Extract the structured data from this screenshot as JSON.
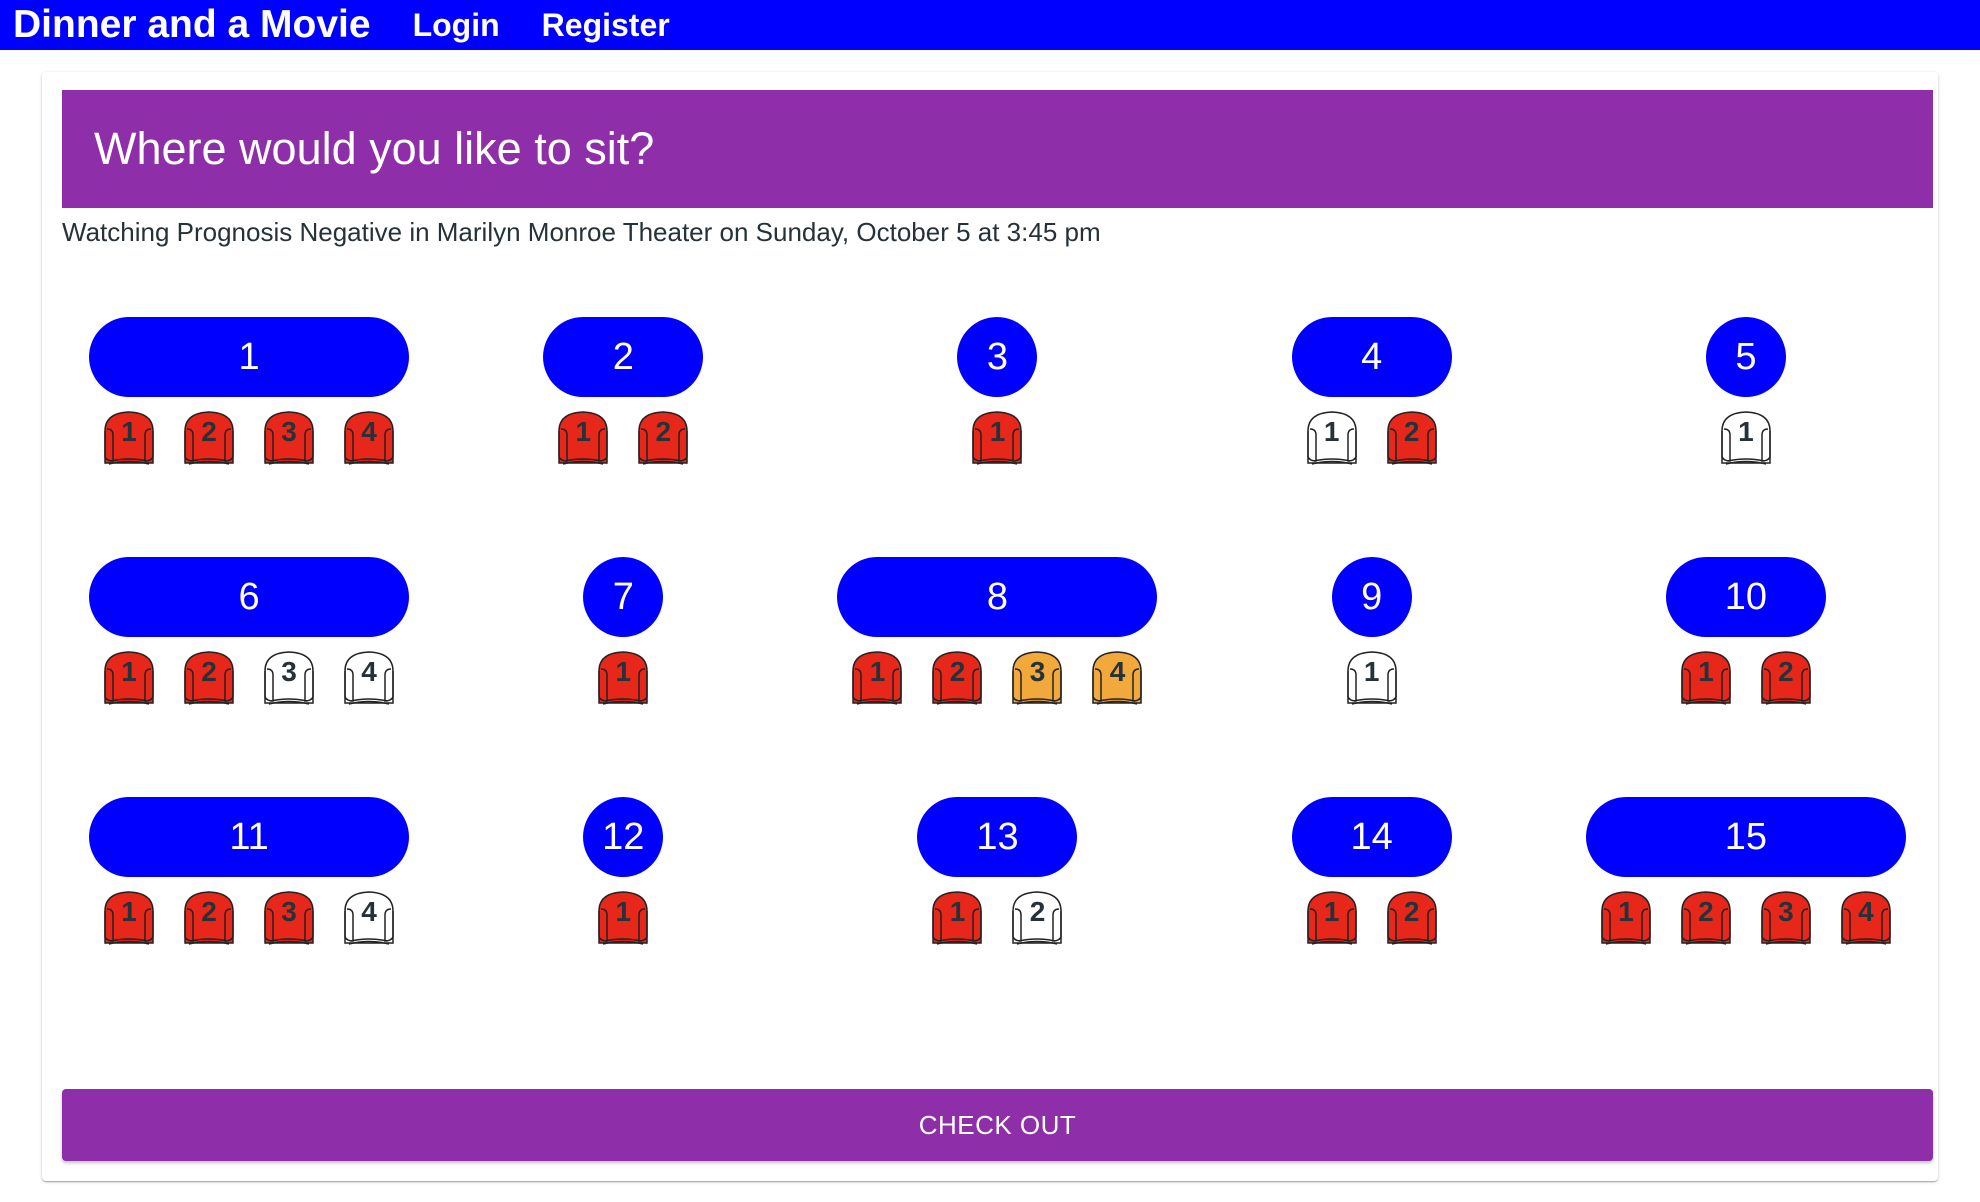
{
  "navbar": {
    "brand": "Dinner and a Movie",
    "links": [
      "Login",
      "Register"
    ],
    "background": "#0000ff"
  },
  "header": {
    "title": "Where would you like to sit?",
    "background": "#8e2fa9"
  },
  "subtitle": "Watching Prognosis Negative in Marilyn Monroe Theater on Sunday, October 5 at 3:45 pm",
  "seat_colors": {
    "taken": "#e8271b",
    "selected": "#f2a93b",
    "available": "#ffffff"
  },
  "tables": [
    {
      "label": "1",
      "seats": [
        {
          "number": "1",
          "status": "taken"
        },
        {
          "number": "2",
          "status": "taken"
        },
        {
          "number": "3",
          "status": "taken"
        },
        {
          "number": "4",
          "status": "taken"
        }
      ]
    },
    {
      "label": "2",
      "seats": [
        {
          "number": "1",
          "status": "taken"
        },
        {
          "number": "2",
          "status": "taken"
        }
      ]
    },
    {
      "label": "3",
      "seats": [
        {
          "number": "1",
          "status": "taken"
        }
      ]
    },
    {
      "label": "4",
      "seats": [
        {
          "number": "1",
          "status": "available"
        },
        {
          "number": "2",
          "status": "taken"
        }
      ]
    },
    {
      "label": "5",
      "seats": [
        {
          "number": "1",
          "status": "available"
        }
      ]
    },
    {
      "label": "6",
      "seats": [
        {
          "number": "1",
          "status": "taken"
        },
        {
          "number": "2",
          "status": "taken"
        },
        {
          "number": "3",
          "status": "available"
        },
        {
          "number": "4",
          "status": "available"
        }
      ]
    },
    {
      "label": "7",
      "seats": [
        {
          "number": "1",
          "status": "taken"
        }
      ]
    },
    {
      "label": "8",
      "seats": [
        {
          "number": "1",
          "status": "taken"
        },
        {
          "number": "2",
          "status": "taken"
        },
        {
          "number": "3",
          "status": "selected"
        },
        {
          "number": "4",
          "status": "selected"
        }
      ]
    },
    {
      "label": "9",
      "seats": [
        {
          "number": "1",
          "status": "available"
        }
      ]
    },
    {
      "label": "10",
      "seats": [
        {
          "number": "1",
          "status": "taken"
        },
        {
          "number": "2",
          "status": "taken"
        }
      ]
    },
    {
      "label": "11",
      "seats": [
        {
          "number": "1",
          "status": "taken"
        },
        {
          "number": "2",
          "status": "taken"
        },
        {
          "number": "3",
          "status": "taken"
        },
        {
          "number": "4",
          "status": "available"
        }
      ]
    },
    {
      "label": "12",
      "seats": [
        {
          "number": "1",
          "status": "taken"
        }
      ]
    },
    {
      "label": "13",
      "seats": [
        {
          "number": "1",
          "status": "taken"
        },
        {
          "number": "2",
          "status": "available"
        }
      ]
    },
    {
      "label": "14",
      "seats": [
        {
          "number": "1",
          "status": "taken"
        },
        {
          "number": "2",
          "status": "taken"
        }
      ]
    },
    {
      "label": "15",
      "seats": [
        {
          "number": "1",
          "status": "taken"
        },
        {
          "number": "2",
          "status": "taken"
        },
        {
          "number": "3",
          "status": "taken"
        },
        {
          "number": "4",
          "status": "taken"
        }
      ]
    }
  ],
  "checkout_label": "CHECK OUT"
}
